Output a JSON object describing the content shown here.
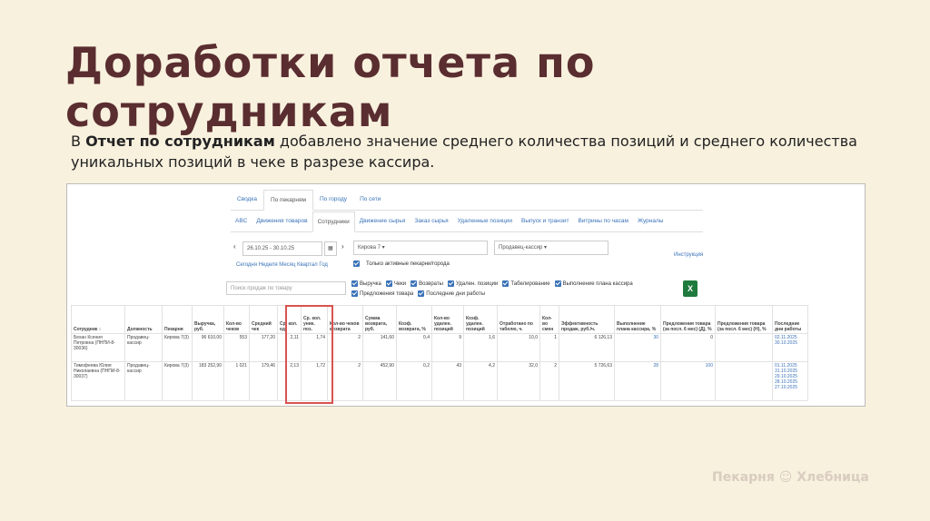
{
  "slide": {
    "title": "Доработки отчета по сотрудникам",
    "desc_prefix": "В ",
    "desc_bold": "Отчет по сотрудникам",
    "desc_rest": " добавлено значение среднего количества позиций и среднего количества уникальных позиций в чеке в разрезе кассира.",
    "brand": "Пекарня ☺ Хлебница"
  },
  "nav": {
    "tabs1": [
      "Сводка",
      "По пекарням",
      "По городу",
      "По сети"
    ],
    "tabs1_active": 1,
    "tabs2": [
      "ABC",
      "Движения товаров",
      "Сотрудники",
      "Движение сырья",
      "Заказ сырья",
      "Удаленные позиции",
      "Выпуск и транзит",
      "Витрины по часам",
      "Журналы"
    ],
    "tabs2_active": 2
  },
  "filters": {
    "date_range": "26.10.25 - 30.10.25",
    "bakery": "Кирова 7 ▾",
    "role": "Продавец-кассир ▾",
    "instruction": "Инструкция",
    "periods": "Сегодня  Неделя  Месяц  Квартал  Год",
    "only_active": "Только активные пекарни/города",
    "search_placeholder": "Поиск продаж по товару",
    "checks1": [
      "Выручка",
      "Чеки",
      "Возвраты",
      "Удален. позиции",
      "Табелирование",
      "Выполнение плана кассира"
    ],
    "checks2": [
      "Предложения товара",
      "Последние дни работы"
    ]
  },
  "table": {
    "headers": [
      "Сотрудник ↕",
      "Должность",
      "Пекарня",
      "Выручка, руб.",
      "Кол-во чеков",
      "Средний чек",
      "Ср. кол. ед.",
      "Ср. кол. уник. поз.",
      "Кол-во чеков возврата",
      "Сумма возврата, руб.",
      "Коэф. возврата, %",
      "Кол-во удален. позиций",
      "Коэф. удален. позиций",
      "Отработано по табелю, ч.",
      "Кол-во смен",
      "Эффективность продаж, руб./ч.",
      "Выполнение плана кассира, %",
      "Предложения товара (за посл. 6 мес) (Д), %",
      "Предложения товара (за посл. 6 мес) (Н), %",
      "Последние дни работы"
    ],
    "rows": [
      [
        "Бехан Ксения Петровна (ПНПИ-8-30036)",
        "Продавец-кассир",
        "Кирова 7(3)",
        "96 610,00",
        "553",
        "177,20",
        "2,11",
        "1,74",
        "2",
        "141,60",
        "0,4",
        "9",
        "1,6",
        "10,0",
        "1",
        "6 126,13",
        "30",
        "0",
        "",
        "02.11.2025\n30.10.2025"
      ],
      [
        "Тимофеева Юлия Николаевна (ПНПИ-8-30037)",
        "Продавец-кассир",
        "Кирова 7(3)",
        "183 252,90",
        "1 021",
        "179,46",
        "2,13",
        "1,72",
        "2",
        "452,90",
        "0,2",
        "43",
        "4,2",
        "32,0",
        "2",
        "5 726,63",
        "28",
        "100",
        "",
        "01.11.2025\n31.10.2025\n29.10.2025\n28.10.2025\n27.10.2025"
      ]
    ]
  }
}
